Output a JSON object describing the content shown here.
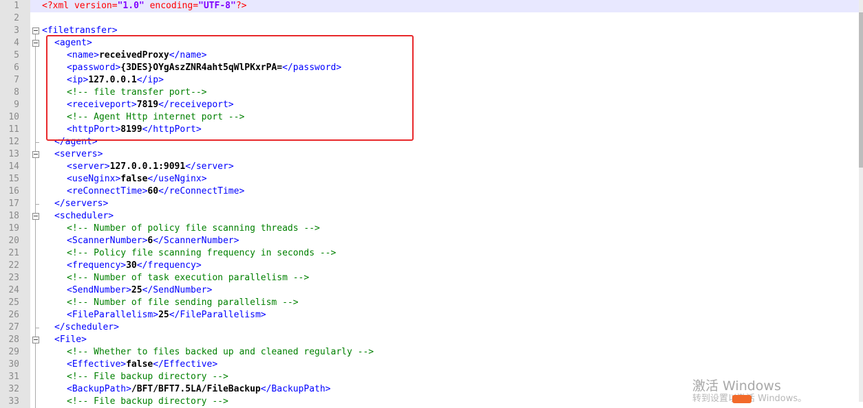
{
  "editor": {
    "lines": [
      {
        "n": "1",
        "indent": 0,
        "fold": "none",
        "current": true,
        "parts": [
          {
            "c": "decl",
            "t": "<?xml "
          },
          {
            "c": "attr",
            "t": "version"
          },
          {
            "c": "decl",
            "t": "="
          },
          {
            "c": "str",
            "t": "\"1.0\""
          },
          {
            "c": "decl",
            "t": " "
          },
          {
            "c": "attr",
            "t": "encoding"
          },
          {
            "c": "decl",
            "t": "="
          },
          {
            "c": "str",
            "t": "\"UTF-8\""
          },
          {
            "c": "decl",
            "t": "?>"
          }
        ]
      },
      {
        "n": "2",
        "indent": 0,
        "fold": "none",
        "parts": []
      },
      {
        "n": "3",
        "indent": 0,
        "fold": "open-root",
        "parts": [
          {
            "c": "tag",
            "t": "<filetransfer>"
          }
        ]
      },
      {
        "n": "4",
        "indent": 1,
        "fold": "open",
        "parts": [
          {
            "c": "tag",
            "t": "<agent>"
          }
        ]
      },
      {
        "n": "5",
        "indent": 2,
        "fold": "line",
        "parts": [
          {
            "c": "tag",
            "t": "<name>"
          },
          {
            "c": "txt",
            "t": "receivedProxy"
          },
          {
            "c": "tag",
            "t": "</name>"
          }
        ]
      },
      {
        "n": "6",
        "indent": 2,
        "fold": "line",
        "parts": [
          {
            "c": "tag",
            "t": "<password>"
          },
          {
            "c": "txt",
            "t": "{3DES}OYgAszZNR4aht5qWlPKxrPA="
          },
          {
            "c": "tag",
            "t": "</password>"
          }
        ]
      },
      {
        "n": "7",
        "indent": 2,
        "fold": "line",
        "parts": [
          {
            "c": "tag",
            "t": "<ip>"
          },
          {
            "c": "txt",
            "t": "127.0.0.1"
          },
          {
            "c": "tag",
            "t": "</ip>"
          }
        ]
      },
      {
        "n": "8",
        "indent": 2,
        "fold": "line",
        "parts": [
          {
            "c": "cmt",
            "t": "<!-- file transfer port-->"
          }
        ]
      },
      {
        "n": "9",
        "indent": 2,
        "fold": "line",
        "parts": [
          {
            "c": "tag",
            "t": "<receiveport>"
          },
          {
            "c": "txt",
            "t": "7819"
          },
          {
            "c": "tag",
            "t": "</receiveport>"
          }
        ]
      },
      {
        "n": "10",
        "indent": 2,
        "fold": "line",
        "parts": [
          {
            "c": "cmt",
            "t": "<!-- Agent Http internet port -->"
          }
        ]
      },
      {
        "n": "11",
        "indent": 2,
        "fold": "line",
        "parts": [
          {
            "c": "tag",
            "t": "<httpPort>"
          },
          {
            "c": "txt",
            "t": "8199"
          },
          {
            "c": "tag",
            "t": "</httpPort>"
          }
        ]
      },
      {
        "n": "12",
        "indent": 1,
        "fold": "end",
        "parts": [
          {
            "c": "tag",
            "t": "</agent>"
          }
        ]
      },
      {
        "n": "13",
        "indent": 1,
        "fold": "open",
        "parts": [
          {
            "c": "tag",
            "t": "<servers>"
          }
        ]
      },
      {
        "n": "14",
        "indent": 2,
        "fold": "line",
        "parts": [
          {
            "c": "tag",
            "t": "<server>"
          },
          {
            "c": "txt",
            "t": "127.0.0.1:9091"
          },
          {
            "c": "tag",
            "t": "</server>"
          }
        ]
      },
      {
        "n": "15",
        "indent": 2,
        "fold": "line",
        "parts": [
          {
            "c": "tag",
            "t": "<useNginx>"
          },
          {
            "c": "txt",
            "t": "false"
          },
          {
            "c": "tag",
            "t": "</useNginx>"
          }
        ]
      },
      {
        "n": "16",
        "indent": 2,
        "fold": "line",
        "parts": [
          {
            "c": "tag",
            "t": "<reConnectTime>"
          },
          {
            "c": "txt",
            "t": "60"
          },
          {
            "c": "tag",
            "t": "</reConnectTime>"
          }
        ]
      },
      {
        "n": "17",
        "indent": 1,
        "fold": "end",
        "parts": [
          {
            "c": "tag",
            "t": "</servers>"
          }
        ]
      },
      {
        "n": "18",
        "indent": 1,
        "fold": "open",
        "parts": [
          {
            "c": "tag",
            "t": "<scheduler>"
          }
        ]
      },
      {
        "n": "19",
        "indent": 2,
        "fold": "line",
        "parts": [
          {
            "c": "cmt",
            "t": "<!-- Number of policy file scanning threads -->"
          }
        ]
      },
      {
        "n": "20",
        "indent": 2,
        "fold": "line",
        "parts": [
          {
            "c": "tag",
            "t": "<ScannerNumber>"
          },
          {
            "c": "txt",
            "t": "6"
          },
          {
            "c": "tag",
            "t": "</ScannerNumber>"
          }
        ]
      },
      {
        "n": "21",
        "indent": 2,
        "fold": "line",
        "parts": [
          {
            "c": "cmt",
            "t": "<!-- Policy file scanning frequency in seconds -->"
          }
        ]
      },
      {
        "n": "22",
        "indent": 2,
        "fold": "line",
        "parts": [
          {
            "c": "tag",
            "t": "<frequency>"
          },
          {
            "c": "txt",
            "t": "30"
          },
          {
            "c": "tag",
            "t": "</frequency>"
          }
        ]
      },
      {
        "n": "23",
        "indent": 2,
        "fold": "line",
        "parts": [
          {
            "c": "cmt",
            "t": "<!-- Number of task execution parallelism -->"
          }
        ]
      },
      {
        "n": "24",
        "indent": 2,
        "fold": "line",
        "parts": [
          {
            "c": "tag",
            "t": "<SendNumber>"
          },
          {
            "c": "txt",
            "t": "25"
          },
          {
            "c": "tag",
            "t": "</SendNumber>"
          }
        ]
      },
      {
        "n": "25",
        "indent": 2,
        "fold": "line",
        "parts": [
          {
            "c": "cmt",
            "t": "<!-- Number of file sending parallelism -->"
          }
        ]
      },
      {
        "n": "26",
        "indent": 2,
        "fold": "line",
        "parts": [
          {
            "c": "tag",
            "t": "<FileParallelism>"
          },
          {
            "c": "txt",
            "t": "25"
          },
          {
            "c": "tag",
            "t": "</FileParallelism>"
          }
        ]
      },
      {
        "n": "27",
        "indent": 1,
        "fold": "end",
        "parts": [
          {
            "c": "tag",
            "t": "</scheduler>"
          }
        ]
      },
      {
        "n": "28",
        "indent": 1,
        "fold": "open",
        "parts": [
          {
            "c": "tag",
            "t": "<File>"
          }
        ]
      },
      {
        "n": "29",
        "indent": 2,
        "fold": "line",
        "parts": [
          {
            "c": "cmt",
            "t": "<!-- Whether to files backed up and cleaned regularly -->"
          }
        ]
      },
      {
        "n": "30",
        "indent": 2,
        "fold": "line",
        "parts": [
          {
            "c": "tag",
            "t": "<Effective>"
          },
          {
            "c": "txt",
            "t": "false"
          },
          {
            "c": "tag",
            "t": "</Effective>"
          }
        ]
      },
      {
        "n": "31",
        "indent": 2,
        "fold": "line",
        "parts": [
          {
            "c": "cmt",
            "t": "<!-- File backup directory -->"
          }
        ]
      },
      {
        "n": "32",
        "indent": 2,
        "fold": "line",
        "parts": [
          {
            "c": "tag",
            "t": "<BackupPath>"
          },
          {
            "c": "txt",
            "t": "/BFT/BFT7.5LA/FileBackup"
          },
          {
            "c": "tag",
            "t": "</BackupPath>"
          }
        ]
      },
      {
        "n": "33",
        "indent": 2,
        "fold": "line",
        "parts": [
          {
            "c": "cmt",
            "t": "<!-- File backup directory -->"
          }
        ]
      }
    ]
  },
  "colors": {
    "tag": "#0000ff",
    "text": "#000000",
    "comment": "#008000",
    "highlight_box": "#e8282b"
  },
  "watermark": {
    "line1": "激活 Windows",
    "line2": "转到设置以激活 Windows。"
  }
}
